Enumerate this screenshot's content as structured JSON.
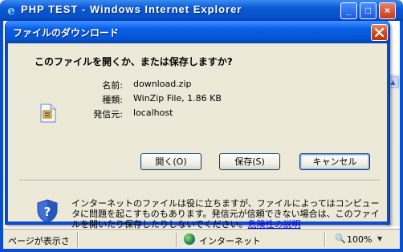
{
  "browser": {
    "title": "PHP TEST - Windows Internet Explorer",
    "minimize": "_",
    "maximize": "□",
    "close": "×",
    "status_text": "ページが表示さ",
    "zone": "インターネット",
    "zoom": "100%",
    "zoom_arrow": "▼"
  },
  "dialog": {
    "title": "ファイルのダウンロード",
    "question": "このファイルを開くか、または保存しますか?",
    "fields": {
      "name_label": "名前:",
      "name_value": "download.zip",
      "type_label": "種類:",
      "type_value": "WinZip File, 1.86 KB",
      "from_label": "発信元:",
      "from_value": "localhost"
    },
    "buttons": {
      "open": "開く(O)",
      "save": "保存(S)",
      "cancel": "キャンセル"
    },
    "warning_text": "インターネットのファイルは役に立ちますが、ファイルによってはコンピュータに問題を起こすものもあります。発信元が信頼できない場合は、このファイルを開いたり保存したりしないでください。",
    "warning_link": "危険性の説明"
  },
  "icons": {
    "file": "zip-file-icon",
    "shield": "security-shield-icon",
    "globe": "internet-zone-icon",
    "zoom": "zoom-icon"
  },
  "colors": {
    "titlebar": "#0a5fe6",
    "dialog_bg": "#ece9d8",
    "close_button": "#d04a20",
    "link": "#0000e0"
  }
}
